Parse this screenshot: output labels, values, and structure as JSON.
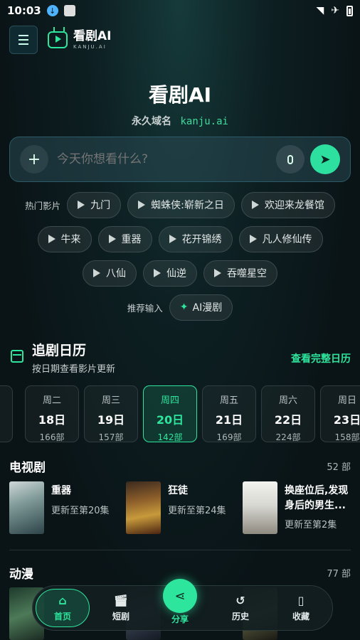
{
  "status_bar": {
    "time": "10:03"
  },
  "app": {
    "name": "看剧AI",
    "sub": "KANJU.AI"
  },
  "hero": {
    "title": "看剧AI",
    "domain_label": "永久域名",
    "domain": "kanju.ai"
  },
  "search": {
    "placeholder": "今天你想看什么?"
  },
  "hot": {
    "label": "热门影片",
    "rows": [
      [
        "九门",
        "蜘蛛侠:崭新之日",
        "欢迎来龙餐馆"
      ],
      [
        "牛来",
        "重器",
        "花开锦绣",
        "凡人修仙传"
      ],
      [
        "八仙",
        "仙逆",
        "吞噬星空"
      ]
    ]
  },
  "recommend": {
    "label": "推荐输入",
    "chip": "AI漫剧"
  },
  "calendar": {
    "title": "追剧日历",
    "subtitle": "按日期查看影片更新",
    "link": "查看完整日历",
    "days": [
      {
        "weekday": "周二",
        "date": "18日",
        "count": "166部"
      },
      {
        "weekday": "周三",
        "date": "19日",
        "count": "157部"
      },
      {
        "weekday": "周四",
        "date": "20日",
        "count": "142部",
        "active": true
      },
      {
        "weekday": "周五",
        "date": "21日",
        "count": "169部"
      },
      {
        "weekday": "周六",
        "date": "22日",
        "count": "224部"
      },
      {
        "weekday": "周日",
        "date": "23日",
        "count": "158部"
      }
    ]
  },
  "tv": {
    "title": "电视剧",
    "count": "52 部",
    "items": [
      {
        "title": "重器",
        "update": "更新至第20集"
      },
      {
        "title": "狂徒",
        "update": "更新至第24集"
      },
      {
        "title": "换座位后,发现身后的男生...",
        "update": "更新至第2集"
      }
    ]
  },
  "anime": {
    "title": "动漫",
    "count": "77 部"
  },
  "nav": {
    "home": "首页",
    "short": "短剧",
    "share": "分享",
    "history": "历史",
    "fav": "收藏"
  },
  "colors": {
    "accent": "#2ee59d",
    "background": "#0d1f22"
  }
}
